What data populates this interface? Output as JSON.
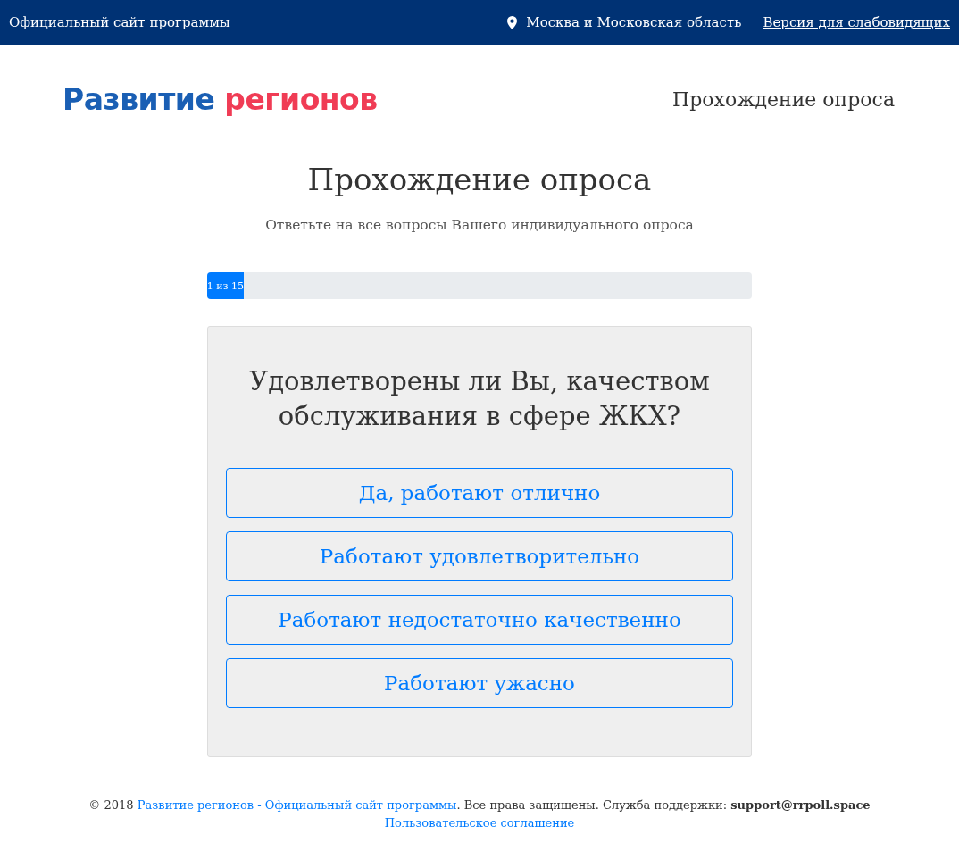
{
  "top_bar": {
    "title": "Официальный сайт программы",
    "region": "Москва и Московская область",
    "accessibility_link": "Версия для слабовидящих"
  },
  "header": {
    "logo": [
      "Развитие",
      "регионов"
    ],
    "nav_title": "Прохождение опроса"
  },
  "page": {
    "title": "Прохождение опроса",
    "subtitle": "Ответьте на все вопросы Вашего индивидуального опроса"
  },
  "progress": {
    "label": "1 из 15",
    "level": 0.0667
  },
  "question": {
    "text": "Удовлетворены ли Вы, качеством обслуживания в сфере ЖКХ?",
    "answers": [
      "Да, работают отлично",
      "Работают удовлетворительно",
      "Работают недостаточно качественно",
      "Работают ужасно"
    ]
  },
  "footer": {
    "prefix": "© 2018 ",
    "link": "Развитие регионов - Официальный сайт программы",
    "suffix": ". Все права защищены. Служба поддержки: **support@rrpoll.space**",
    "agreement_link": "Пользовательское соглашение"
  }
}
